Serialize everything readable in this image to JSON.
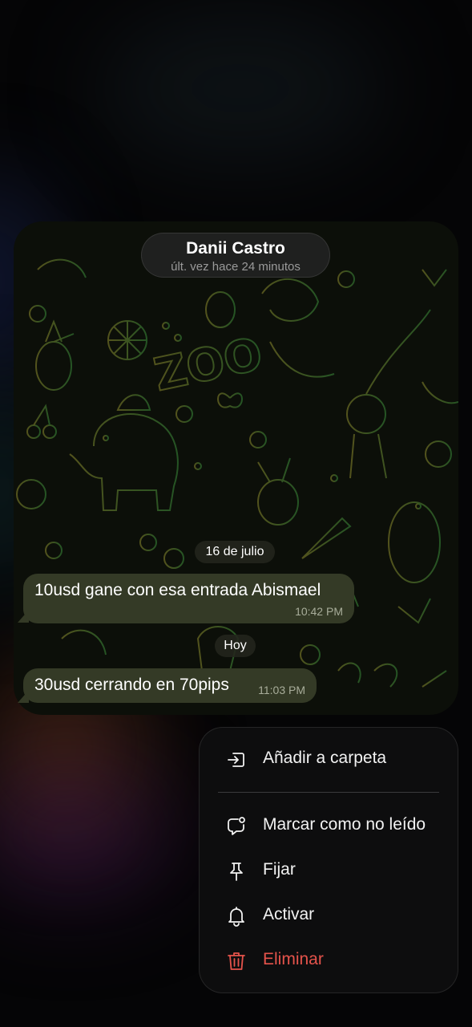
{
  "contact": {
    "name": "Danii Castro",
    "status": "últ. vez hace 24 minutos"
  },
  "messages": [
    {
      "date_label": "16 de julio",
      "text": "10usd gane con esa entrada Abismael",
      "time": "10:42 PM"
    },
    {
      "date_label": "Hoy",
      "text": "30usd cerrando en 70pips",
      "time": "11:03 PM"
    }
  ],
  "menu": {
    "items": [
      {
        "label": "Añadir a carpeta",
        "icon": "folder-add-icon"
      },
      {
        "label": "Marcar como no leído",
        "icon": "mark-unread-icon"
      },
      {
        "label": "Fijar",
        "icon": "pin-icon"
      },
      {
        "label": "Activar",
        "icon": "bell-icon"
      },
      {
        "label": "Eliminar",
        "icon": "trash-icon",
        "destructive": true
      }
    ]
  },
  "colors": {
    "bubble": "#343a26",
    "destructive": "#e5534b",
    "pattern_yellow": "#6b6a24",
    "pattern_green": "#2e6b2e"
  }
}
